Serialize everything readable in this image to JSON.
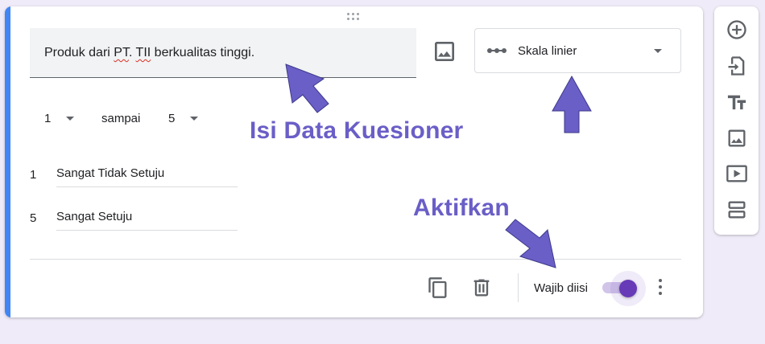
{
  "question": {
    "title_before": "Produk dari ",
    "title_misspelled_1": "PT",
    "title_middle": ". ",
    "title_misspelled_2": "TII",
    "title_after": " berkualitas tinggi."
  },
  "question_type": {
    "selected": "Skala linier"
  },
  "scale": {
    "min_value": "1",
    "connector": "sampai",
    "max_value": "5",
    "labels": [
      {
        "number": "1",
        "text": "Sangat Tidak Setuju"
      },
      {
        "number": "5",
        "text": "Sangat Setuju"
      }
    ]
  },
  "footer": {
    "required_label": "Wajib diisi",
    "required_on": true
  },
  "annotations": {
    "fill_data": "Isi Data Kuesioner",
    "activate": "Aktifkan"
  },
  "colors": {
    "accent": "#673ab7",
    "card_edge": "#4285f4",
    "annotation": "#6a5ec7",
    "background": "#f0ebf8"
  },
  "side_toolbar": {
    "tools": [
      "add-question-icon",
      "import-questions-icon",
      "add-title-icon",
      "add-image-icon",
      "add-video-icon",
      "add-section-icon"
    ]
  }
}
